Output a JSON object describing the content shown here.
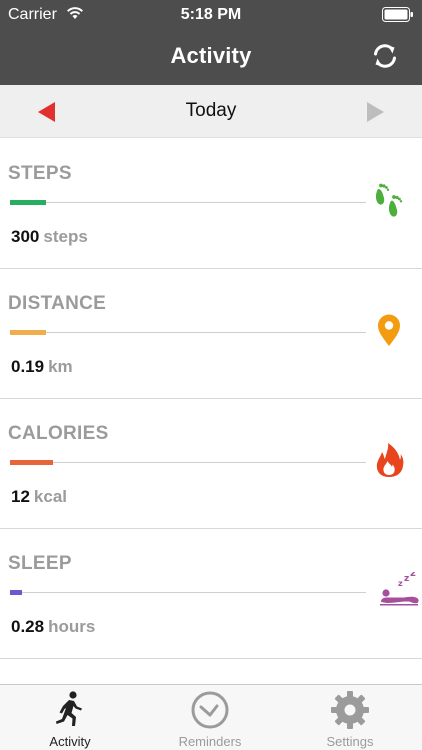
{
  "status_bar": {
    "carrier": "Carrier",
    "time": "5:18 PM"
  },
  "nav": {
    "title": "Activity",
    "refresh_icon": "refresh-icon"
  },
  "date_nav": {
    "label": "Today",
    "prev_icon": "triangle-left-icon",
    "next_icon": "triangle-right-icon"
  },
  "metrics": [
    {
      "title": "STEPS",
      "value": "300",
      "unit": "steps",
      "progress": 0.1,
      "color": "#27ae60",
      "icon": "footprints-icon"
    },
    {
      "title": "DISTANCE",
      "value": "0.19",
      "unit": "km",
      "progress": 0.1,
      "color": "#f0ad4e",
      "icon": "map-pin-icon"
    },
    {
      "title": "CALORIES",
      "value": "12",
      "unit": "kcal",
      "progress": 0.12,
      "color": "#e8643a",
      "icon": "flame-icon"
    },
    {
      "title": "SLEEP",
      "value": "0.28",
      "unit": "hours",
      "progress": 0.035,
      "color": "#6a5acd",
      "icon": "sleeping-person-icon"
    }
  ],
  "tabs": [
    {
      "label": "Activity",
      "icon": "runner-icon",
      "active": true
    },
    {
      "label": "Reminders",
      "icon": "clock-icon",
      "active": false
    },
    {
      "label": "Settings",
      "icon": "gear-icon",
      "active": false
    }
  ],
  "colors": {
    "header_bg": "#4d4d4d",
    "prev_arrow": "#e03030",
    "next_arrow": "#bdbdbd",
    "sleep_icon": "#a4509c"
  }
}
